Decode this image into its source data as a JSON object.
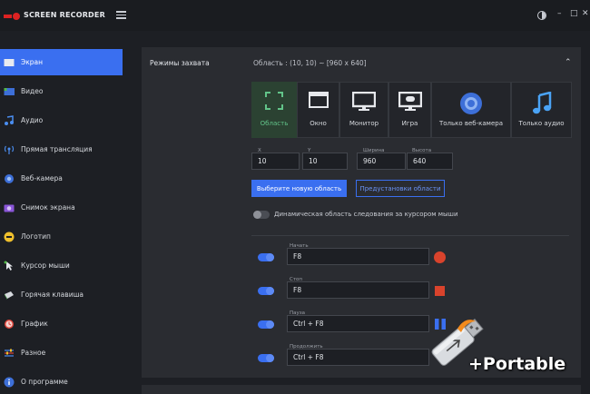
{
  "app": {
    "title": "SCREEN RECORDER"
  },
  "window_controls": {
    "minimize": "–",
    "maximize": "□",
    "close": "✕"
  },
  "sidebar": {
    "items": [
      {
        "label": "Экран",
        "icon": "screen-icon",
        "active": true
      },
      {
        "label": "Видео",
        "icon": "video-icon"
      },
      {
        "label": "Аудио",
        "icon": "audio-icon"
      },
      {
        "label": "Прямая трансляция",
        "icon": "broadcast-icon"
      },
      {
        "label": "Веб-камера",
        "icon": "webcam-icon"
      },
      {
        "label": "Снимок экрана",
        "icon": "camera-icon"
      },
      {
        "label": "Логотип",
        "icon": "logo-icon"
      },
      {
        "label": "Курсор мыши",
        "icon": "cursor-icon"
      },
      {
        "label": "Горячая клавиша",
        "icon": "keyboard-icon"
      },
      {
        "label": "График",
        "icon": "clock-icon"
      },
      {
        "label": "Разное",
        "icon": "sliders-icon"
      },
      {
        "label": "О программе",
        "icon": "info-icon"
      }
    ]
  },
  "capture": {
    "title": "Режимы захвата",
    "region_info": "Область : (10, 10) ~ [960 x 640]",
    "modes": [
      {
        "label": "Область",
        "icon": "region-icon",
        "active": true
      },
      {
        "label": "Окно",
        "icon": "window-icon"
      },
      {
        "label": "Монитор",
        "icon": "monitor-icon"
      },
      {
        "label": "Игра",
        "icon": "game-icon"
      },
      {
        "label": "Только веб-камера",
        "icon": "webcam-only-icon"
      },
      {
        "label": "Только аудио",
        "icon": "music-note-icon"
      }
    ],
    "fields": {
      "x": {
        "label": "X",
        "value": "10"
      },
      "y": {
        "label": "Y",
        "value": "10"
      },
      "width": {
        "label": "Ширина",
        "value": "960"
      },
      "height": {
        "label": "Высота",
        "value": "640"
      }
    },
    "select_area_button": "Выберите новую область",
    "preview_area_button": "Предустановки области",
    "dynamic_area_label": "Динамическая область следования за курсором мыши",
    "hotkeys": [
      {
        "label": "Начать",
        "value": "F8",
        "icon": "record-icon"
      },
      {
        "label": "Стоп",
        "value": "F8",
        "icon": "stop-icon"
      },
      {
        "label": "Пауза",
        "value": "Ctrl + F8",
        "icon": "pause-icon"
      },
      {
        "label": "Продолжить",
        "value": "Ctrl + F8",
        "icon": "resume-icon"
      }
    ]
  },
  "colors": {
    "accent": "#3a6ff0",
    "active_mode_text": "#62c489",
    "record": "#d9432c"
  },
  "watermark": {
    "text": "+Portable"
  }
}
